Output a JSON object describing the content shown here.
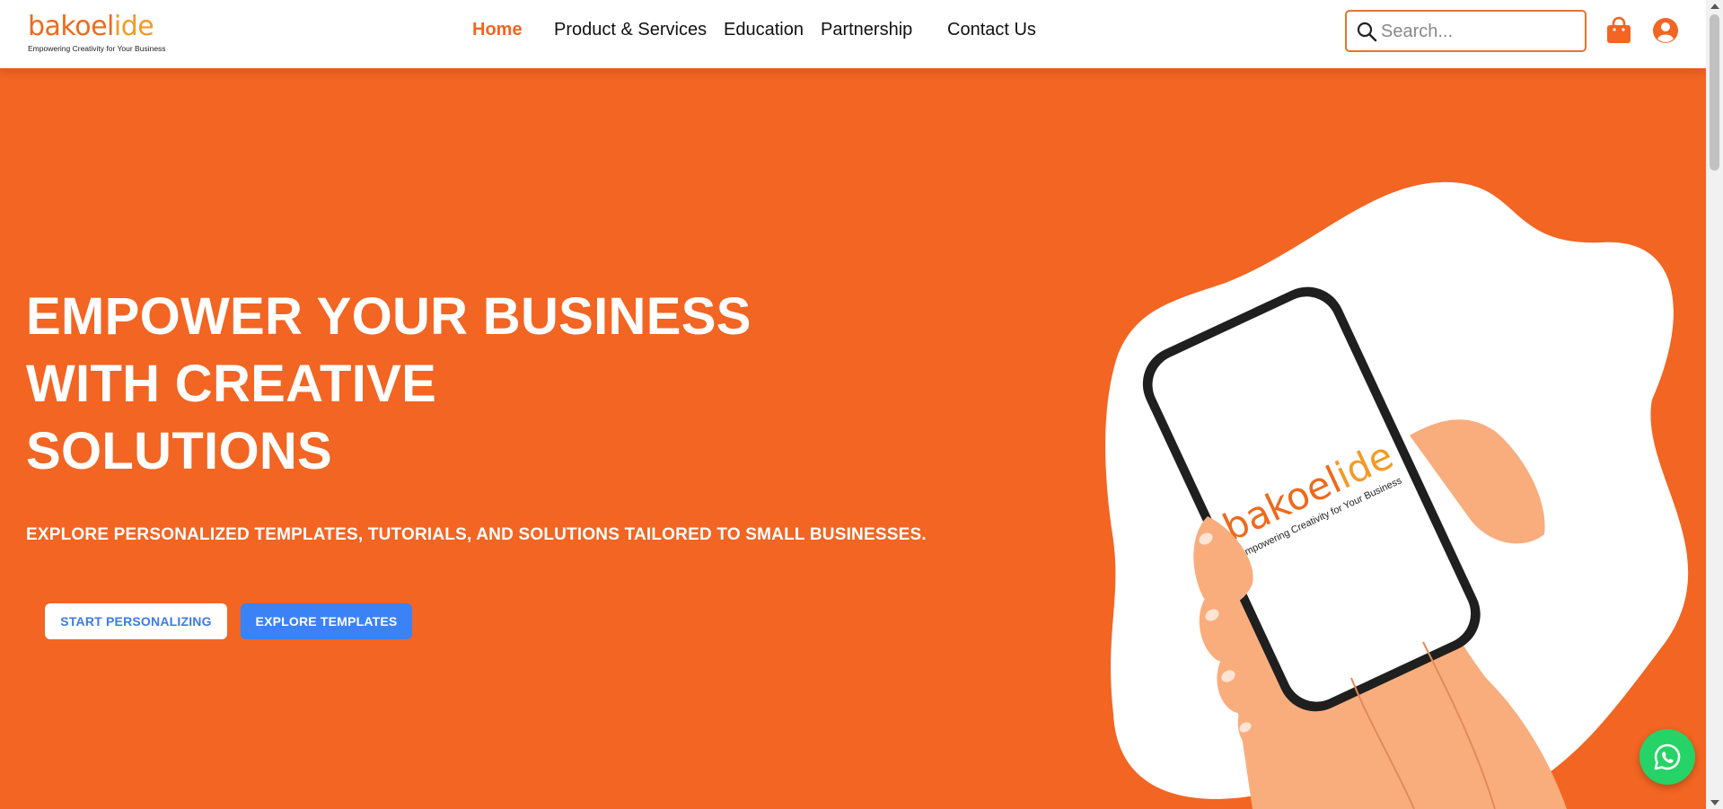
{
  "brand": {
    "name_part1": "bakoel",
    "name_part2": "ide",
    "tagline": "Empowering Creativity for Your Business"
  },
  "nav": {
    "items": [
      {
        "label": "Home",
        "active": true
      },
      {
        "label": "Product & Services",
        "active": false
      },
      {
        "label": "Education",
        "active": false
      },
      {
        "label": "Partnership",
        "active": false
      },
      {
        "label": "Contact Us",
        "active": false
      }
    ]
  },
  "search": {
    "placeholder": "Search...",
    "value": "",
    "icon": "search-icon"
  },
  "header_icons": {
    "cart": "shopping-bag-icon",
    "account": "user-circle-icon"
  },
  "hero": {
    "title_lines": [
      "EMPOWER YOUR BUSINESS",
      "WITH CREATIVE",
      "SOLUTIONS"
    ],
    "subtitle": "EXPLORE PERSONALIZED TEMPLATES, TUTORIALS, AND SOLUTIONS TAILORED TO SMALL BUSINESSES.",
    "primary_button": "START PERSONALIZING",
    "secondary_button": "EXPLORE TEMPLATES",
    "phone_screen": {
      "brand_part1": "bakoel",
      "brand_part2": "ide",
      "tagline": "Empowering Creativity for Your Business"
    }
  },
  "floating": {
    "chat_icon": "whatsapp-icon"
  },
  "colors": {
    "brand_orange": "#f26522",
    "accent_blue": "#3b82f6",
    "whatsapp_green": "#25d366",
    "skin": "#f9ad7d"
  }
}
